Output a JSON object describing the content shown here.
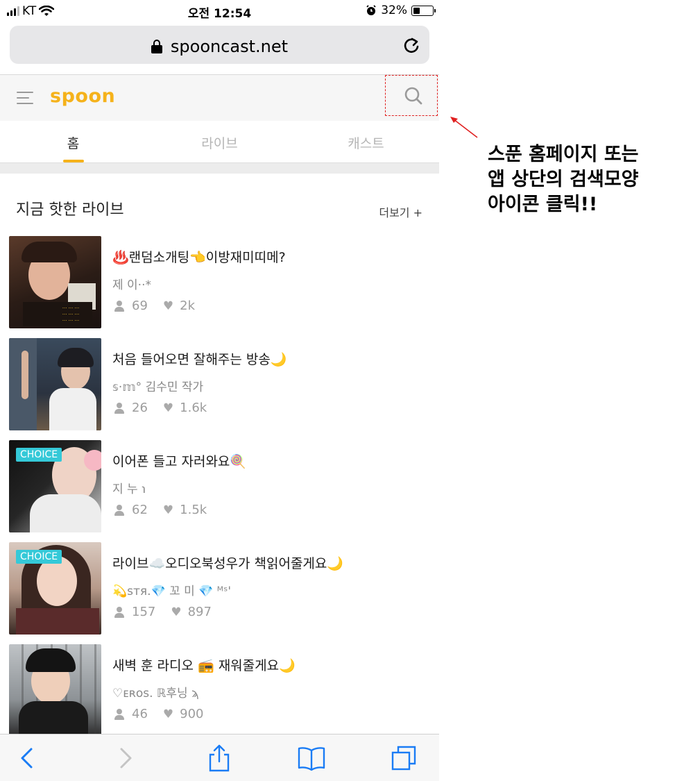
{
  "status_bar": {
    "carrier": "KT",
    "time": "오전 12:54",
    "battery": "32%"
  },
  "browser": {
    "url": "spooncast.net"
  },
  "app": {
    "logo": "spoon",
    "tabs": [
      {
        "label": "홈",
        "active": true
      },
      {
        "label": "라이브",
        "active": false
      },
      {
        "label": "캐스트",
        "active": false
      }
    ],
    "accent_color": "#f5b21b"
  },
  "section": {
    "title": "지금 핫한 라이브",
    "more": "더보기 +"
  },
  "lives": [
    {
      "title": "♨️랜덤소개팅👈이방재미띠메?",
      "author": "제 이··*",
      "listeners": "69",
      "likes": "2k",
      "badge": ""
    },
    {
      "title": "처음 들어오면 잘해주는 방송🌙",
      "author": "𝕤·𝕞° 김수민 작가",
      "listeners": "26",
      "likes": "1.6k",
      "badge": ""
    },
    {
      "title": "이어폰 들고 자러와요🍭",
      "author": "지 누 ℩",
      "listeners": "62",
      "likes": "1.5k",
      "badge": "CHOICE"
    },
    {
      "title": "라이브☁️오디오북성우가 책읽어줄게요🌙",
      "author": "💫sтя.💎 꼬 미 💎     ᴹˢ'",
      "listeners": "157",
      "likes": "897",
      "badge": "CHOICE"
    },
    {
      "title": "새벽 훈 라디오 📻 재워줄게요🌙",
      "author": "♡ᴇʀᴏs. ℝ후닝 ϡ",
      "listeners": "46",
      "likes": "900",
      "badge": ""
    }
  ],
  "annotation": {
    "text": "스푼 홈페이지 또는\n앱 상단의 검색모양\n아이콘 클릭!!",
    "color": "#e02020"
  }
}
